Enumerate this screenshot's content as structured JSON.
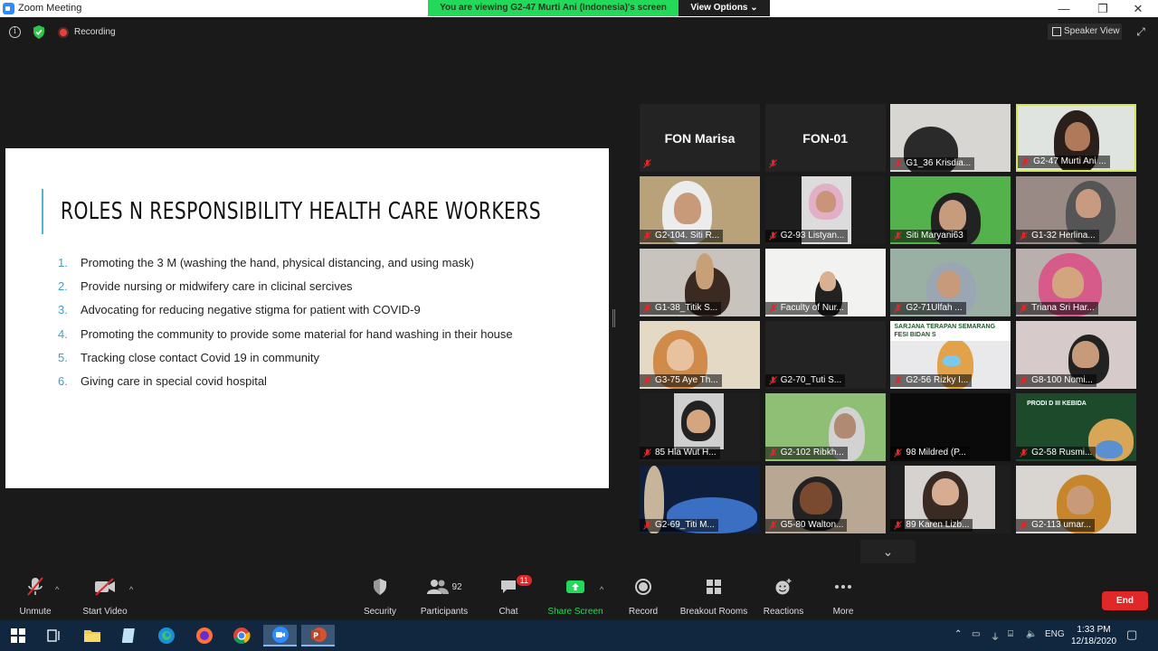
{
  "window": {
    "title": "Zoom Meeting",
    "viewing_banner": "You are viewing G2-47 Murti Ani (Indonesia)'s screen",
    "view_options": "View Options",
    "minimize": "—",
    "maximize": "❐",
    "close": "✕"
  },
  "topbar": {
    "info": "i",
    "recording": "Recording",
    "speaker_view": "Speaker View"
  },
  "slide": {
    "title": "ROLES N RESPONSIBILITY HEALTH CARE WORKERS",
    "items": [
      {
        "num": "1.",
        "text": "Promoting the 3 M (washing the hand, physical distancing, and using mask)"
      },
      {
        "num": "2.",
        "text": "Provide nursing or midwifery care in clicinal sercives"
      },
      {
        "num": "3.",
        "text": " Advocating for reducing negative stigma for patient with COVID-9"
      },
      {
        "num": "4.",
        "text": "Promoting the community to provide some material for hand washing in their house"
      },
      {
        "num": "5.",
        "text": "Tracking close contact  Covid 19 in community"
      },
      {
        "num": "6.",
        "text": "Giving care in special covid hospital"
      }
    ]
  },
  "participants_grid": [
    {
      "name": "FON Marisa",
      "label": "",
      "big": true
    },
    {
      "name": "FON-01",
      "label": "",
      "big": true
    },
    {
      "name": "",
      "label": "G1_36 Krisdia..."
    },
    {
      "name": "",
      "label": "G2-47 Murti Ani ...",
      "active": true
    },
    {
      "name": "",
      "label": "G2-104. Siti R..."
    },
    {
      "name": "",
      "label": "G2-93 Listyan..."
    },
    {
      "name": "",
      "label": "Siti Maryani63"
    },
    {
      "name": "",
      "label": "G1-32 Herlina..."
    },
    {
      "name": "",
      "label": "G1-38_Titik S..."
    },
    {
      "name": "",
      "label": "Faculty of Nur..."
    },
    {
      "name": "",
      "label": "G2-71Ulfah ..."
    },
    {
      "name": "",
      "label": "Triana Sri Har..."
    },
    {
      "name": "",
      "label": "G3-75 Aye Th..."
    },
    {
      "name": "",
      "label": "G2-70_Tuti S..."
    },
    {
      "name": "",
      "label": "G2-56 Rizky I..."
    },
    {
      "name": "",
      "label": "G8-100 Nomi..."
    },
    {
      "name": "",
      "label": "85 Hla Wut H..."
    },
    {
      "name": "",
      "label": "G2-102 Ribkh..."
    },
    {
      "name": "",
      "label": "98 Mildred (P..."
    },
    {
      "name": "",
      "label": "G2-58 Rusmi..."
    },
    {
      "name": "",
      "label": "G2-69_Titi M..."
    },
    {
      "name": "",
      "label": "G5-80 Walton..."
    },
    {
      "name": "",
      "label": "89 Karen Lizb..."
    },
    {
      "name": "",
      "label": "G2-113 umar..."
    }
  ],
  "tile_texts": {
    "sign_a": "SARJANA TERAPAN SEMARANG FESI BIDAN S",
    "sign_b": "PRODI D III KEBIDA"
  },
  "toolbar": {
    "unmute": "Unmute",
    "start_video": "Start Video",
    "security": "Security",
    "participants": "Participants",
    "participants_count": "92",
    "chat": "Chat",
    "chat_badge": "11",
    "share_screen": "Share Screen",
    "record": "Record",
    "breakout_rooms": "Breakout Rooms",
    "reactions": "Reactions",
    "more": "More",
    "end": "End"
  },
  "taskbar": {
    "lang": "ENG",
    "time": "1:33 PM",
    "date": "12/18/2020"
  },
  "colors": {
    "accent_green": "#23d959",
    "end_red": "#e02828",
    "active_tile_border": "#d5e35a",
    "slide_accent": "#53b4d2",
    "taskbar": "#11263f"
  }
}
